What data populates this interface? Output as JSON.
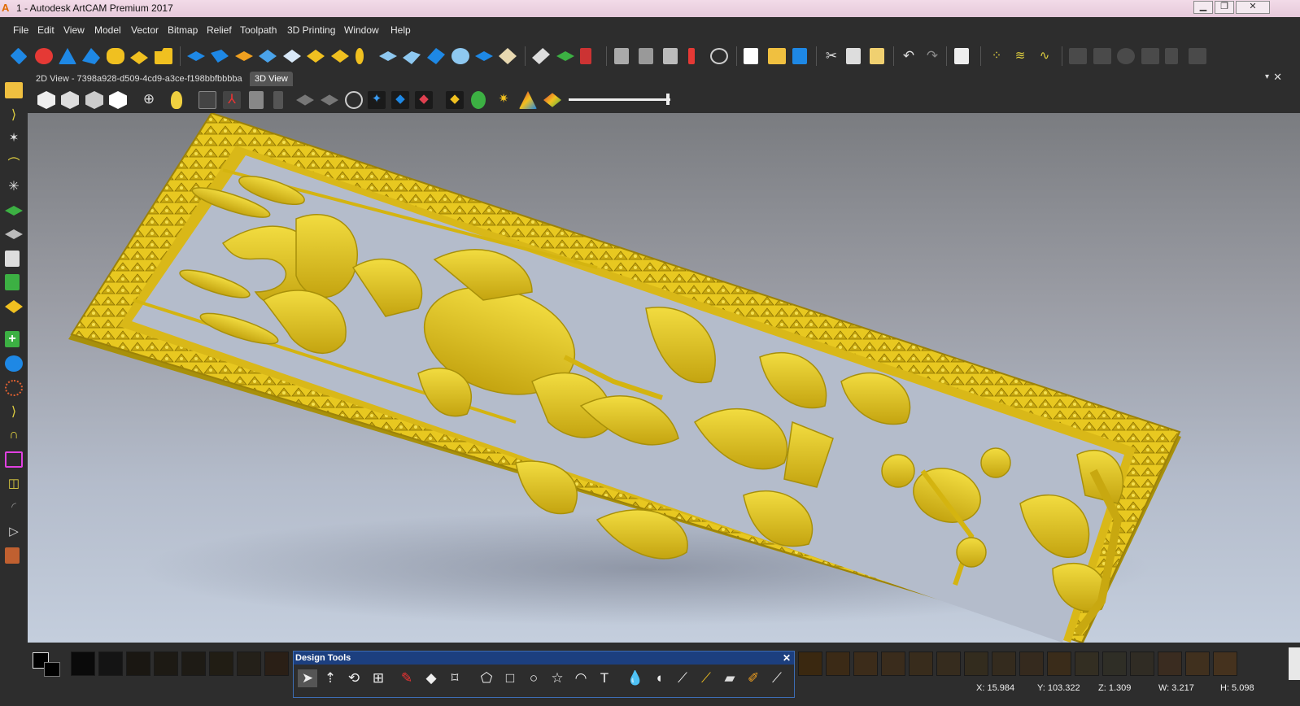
{
  "window": {
    "title": "1 - Autodesk ArtCAM Premium 2017",
    "min_label": "▁",
    "max_label": "❐",
    "close_label": "✕"
  },
  "menu": [
    "File",
    "Edit",
    "View",
    "Model",
    "Vector",
    "Bitmap",
    "Relief",
    "Toolpath",
    "3D Printing",
    "Window",
    "Help"
  ],
  "tabs": {
    "tab_2d": "2D View - 7398a928-d509-4cd9-a3ce-f198bbfbbbba",
    "tab_3d": "3D View",
    "chevron": "▾",
    "close": "✕"
  },
  "design_tools": {
    "title": "Design Tools",
    "close": "✕"
  },
  "status": {
    "x": "X: 15.984",
    "y": "Y: 103.322",
    "z": "Z: 1.309",
    "w": "W: 3.217",
    "h": "H: 5.098"
  },
  "colors": {
    "accent_blue": "#1c3f7f",
    "relief_gold": "#e8c820",
    "relief_shadow": "#a8900a"
  }
}
